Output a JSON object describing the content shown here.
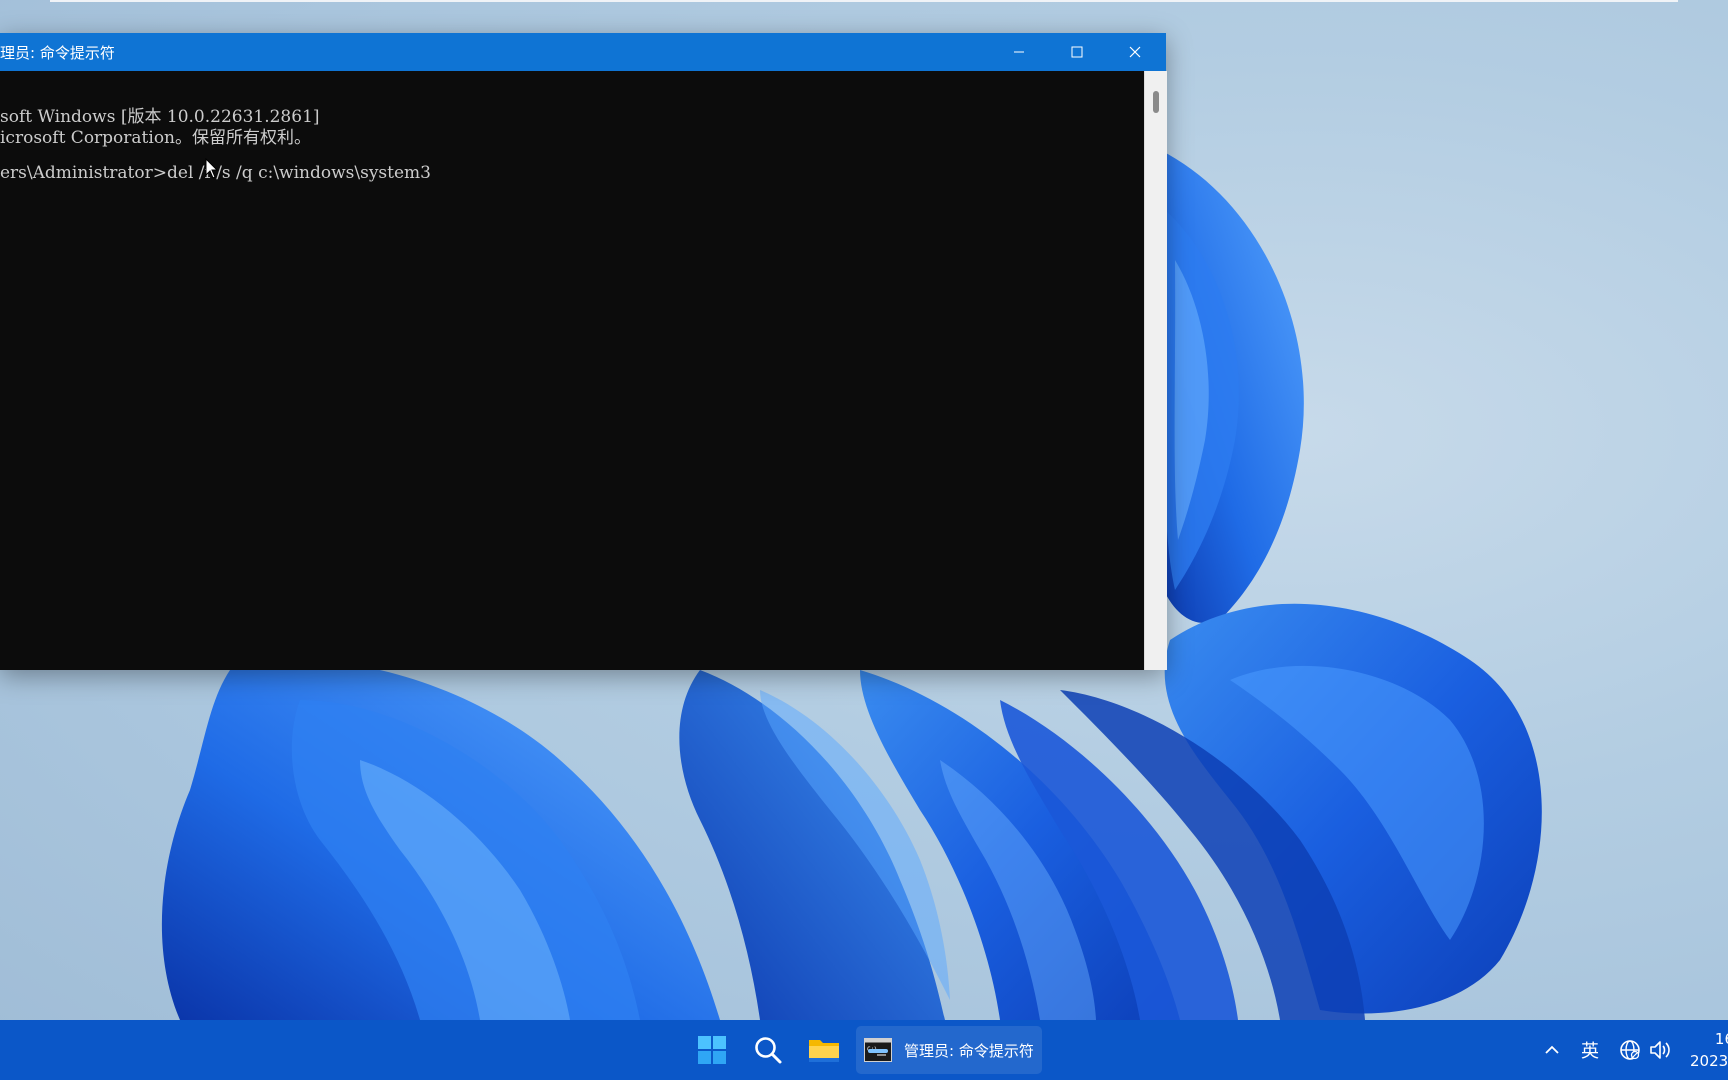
{
  "window": {
    "title": "理员: 命令提示符",
    "minimize_icon": "minimize-icon",
    "maximize_icon": "maximize-icon",
    "close_icon": "close-icon",
    "title_bar_color": "#0f74d4"
  },
  "console": {
    "background": "#0c0c0c",
    "text_color": "#cccccc",
    "lines": [
      "soft Windows [版本 10.0.22631.2861]",
      "icrosoft Corporation。保留所有权利。",
      "",
      "ers\\Administrator>del /f /s /q c:\\windows\\system3"
    ]
  },
  "taskbar": {
    "background": "#0b57c8",
    "start_icon": "windows-start-icon",
    "search_icon": "search-icon",
    "explorer_icon": "folder-icon",
    "cmd_task_icon": "command-prompt-icon",
    "cmd_task_label": "管理员: 命令提示符",
    "tray_chevron_icon": "chevron-up-icon",
    "ime_label": "英",
    "network_icon": "globe-icon",
    "volume_icon": "speaker-icon",
    "clock_time": "16",
    "clock_date": "2023/"
  }
}
